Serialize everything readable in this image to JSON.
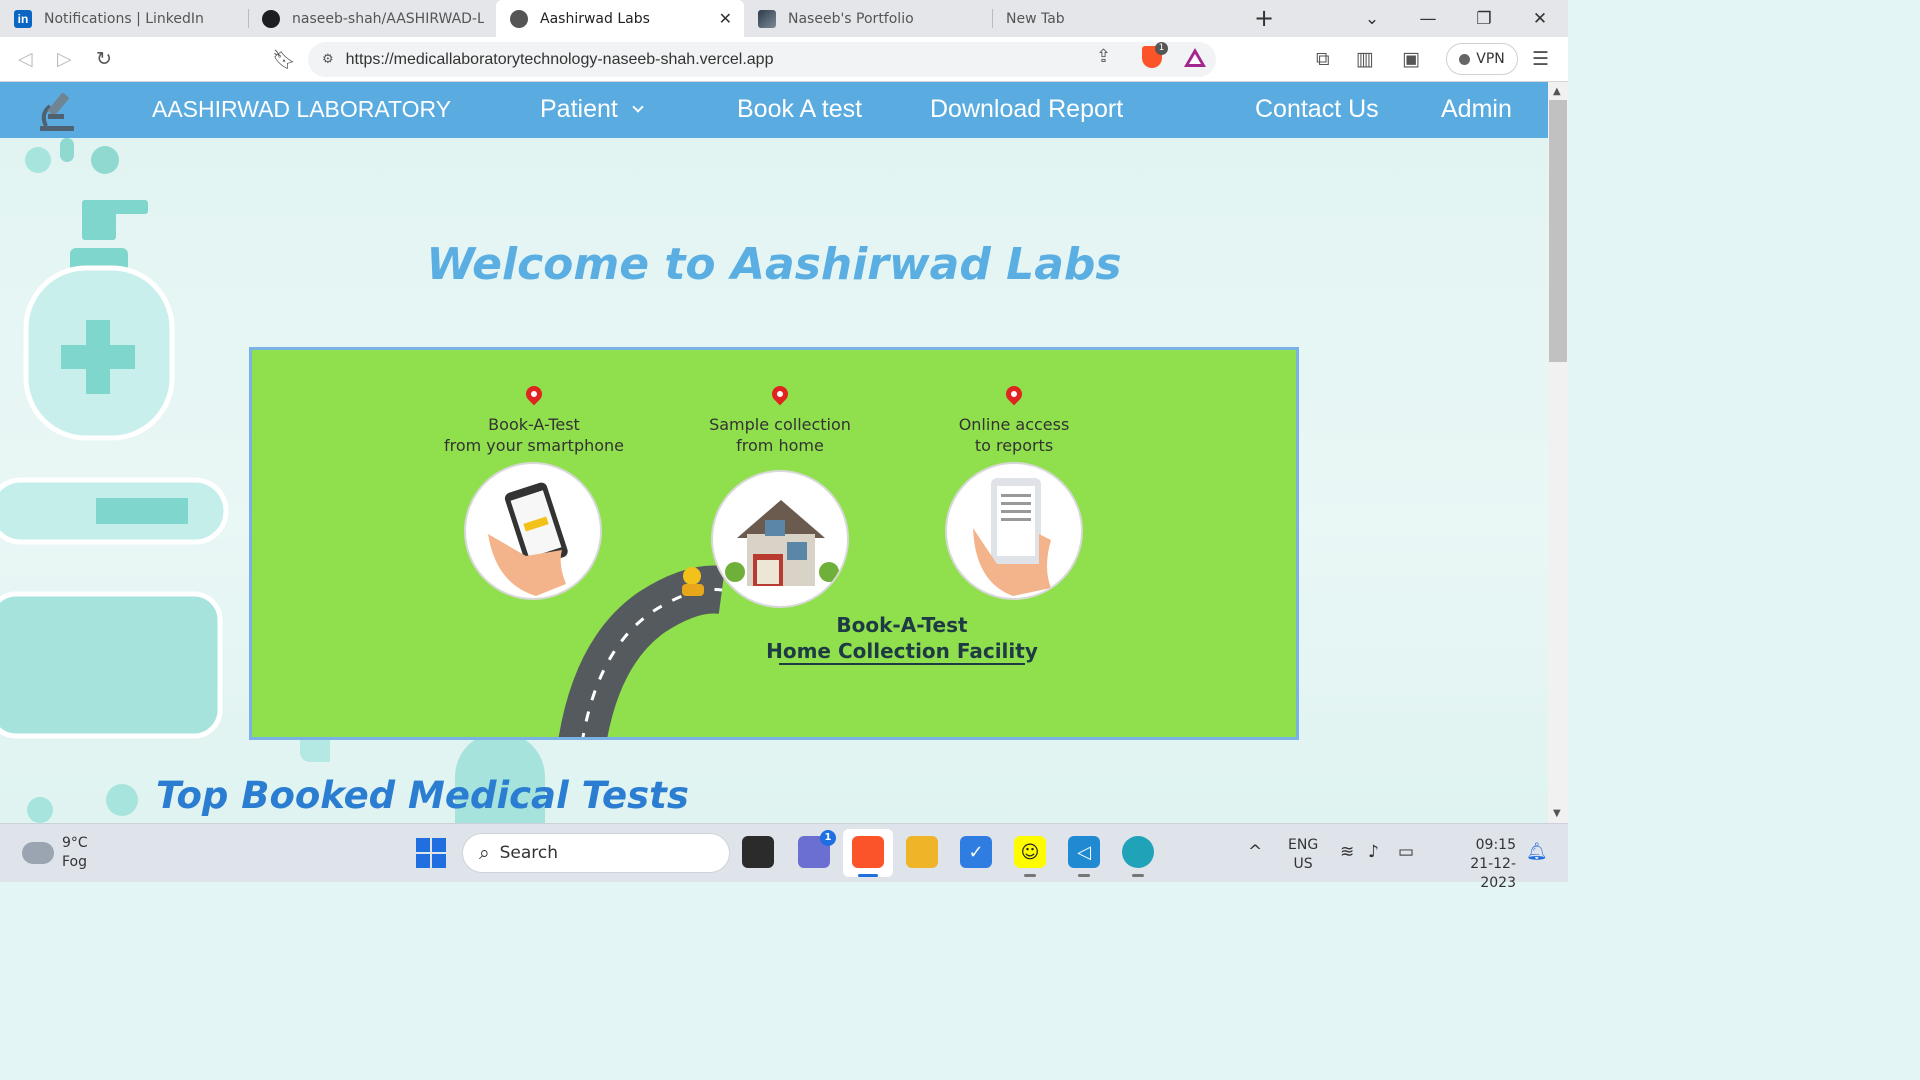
{
  "browser": {
    "tabs": [
      {
        "title": "Notifications | LinkedIn",
        "favicon": "linkedin-icon"
      },
      {
        "title": "naseeb-shah/AASHIRWAD-Lab",
        "favicon": "github-icon"
      },
      {
        "title": "Aashirwad Labs",
        "favicon": "globe-icon",
        "active": true
      },
      {
        "title": "Naseeb's Portfolio",
        "favicon": "portrait-icon"
      },
      {
        "title": "New Tab",
        "favicon": ""
      }
    ],
    "url": "https://medicallaboratorytechnology-naseeb-shah.vercel.app",
    "shield_count": "1",
    "vpn_label": "VPN"
  },
  "nav": {
    "brand": "AASHIRWAD LABORATORY",
    "patient": "Patient",
    "book_test": "Book A test",
    "download_report": "Download Report",
    "contact": "Contact Us",
    "admin": "Admin",
    "accent_color": "#5aabdf"
  },
  "hero": {
    "welcome": "Welcome to Aashirwad Labs",
    "banner": {
      "step1_line1": "Book-A-Test",
      "step1_line2": "from your smartphone",
      "step2_line1": "Sample collection",
      "step2_line2": "from home",
      "step3_line1": "Online access",
      "step3_line2": "to reports",
      "facility_line1": "Book-A-Test",
      "facility_line2": "Home Collection Facility",
      "background": "#8fe04c"
    }
  },
  "section": {
    "top_tests": "Top Booked Medical Tests"
  },
  "taskbar": {
    "temp": "9°C",
    "condition": "Fog",
    "search_placeholder": "Search",
    "teams_badge": "1",
    "lang_line1": "ENG",
    "lang_line2": "US",
    "time": "09:15",
    "date": "21-12-2023"
  }
}
